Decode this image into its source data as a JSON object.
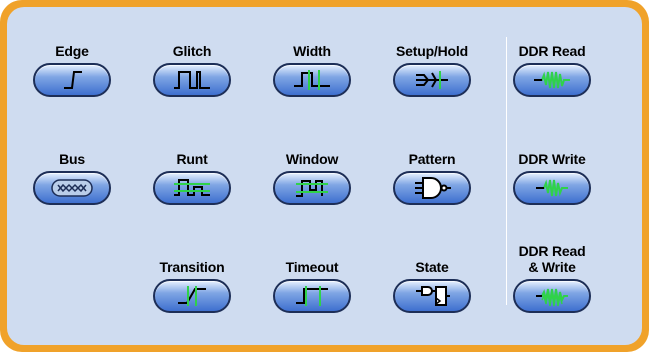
{
  "triggers": [
    {
      "id": "edge",
      "label": "Edge",
      "icon": "edge-trigger-icon"
    },
    {
      "id": "glitch",
      "label": "Glitch",
      "icon": "glitch-trigger-icon"
    },
    {
      "id": "width",
      "label": "Width",
      "icon": "width-trigger-icon"
    },
    {
      "id": "setup-hold",
      "label": "Setup/Hold",
      "icon": "setup-hold-trigger-icon"
    },
    {
      "id": "ddr-read",
      "label": "DDR Read",
      "icon": "ddr-read-trigger-icon"
    },
    {
      "id": "bus",
      "label": "Bus",
      "icon": "bus-trigger-icon"
    },
    {
      "id": "runt",
      "label": "Runt",
      "icon": "runt-trigger-icon"
    },
    {
      "id": "window",
      "label": "Window",
      "icon": "window-trigger-icon"
    },
    {
      "id": "pattern",
      "label": "Pattern",
      "icon": "pattern-trigger-icon"
    },
    {
      "id": "ddr-write",
      "label": "DDR Write",
      "icon": "ddr-write-trigger-icon"
    },
    {
      "id": "transition",
      "label": "Transition",
      "icon": "transition-trigger-icon"
    },
    {
      "id": "timeout",
      "label": "Timeout",
      "icon": "timeout-trigger-icon"
    },
    {
      "id": "state",
      "label": "State",
      "icon": "state-trigger-icon"
    },
    {
      "id": "ddr-read-write",
      "label": "DDR Read\n& Write",
      "icon": "ddr-read-write-trigger-icon"
    }
  ],
  "colors": {
    "frame": "#f0a22a",
    "panel": "#cfdcf0",
    "button_dark": "#1d2e57",
    "waveform_green": "#2fd24a"
  }
}
